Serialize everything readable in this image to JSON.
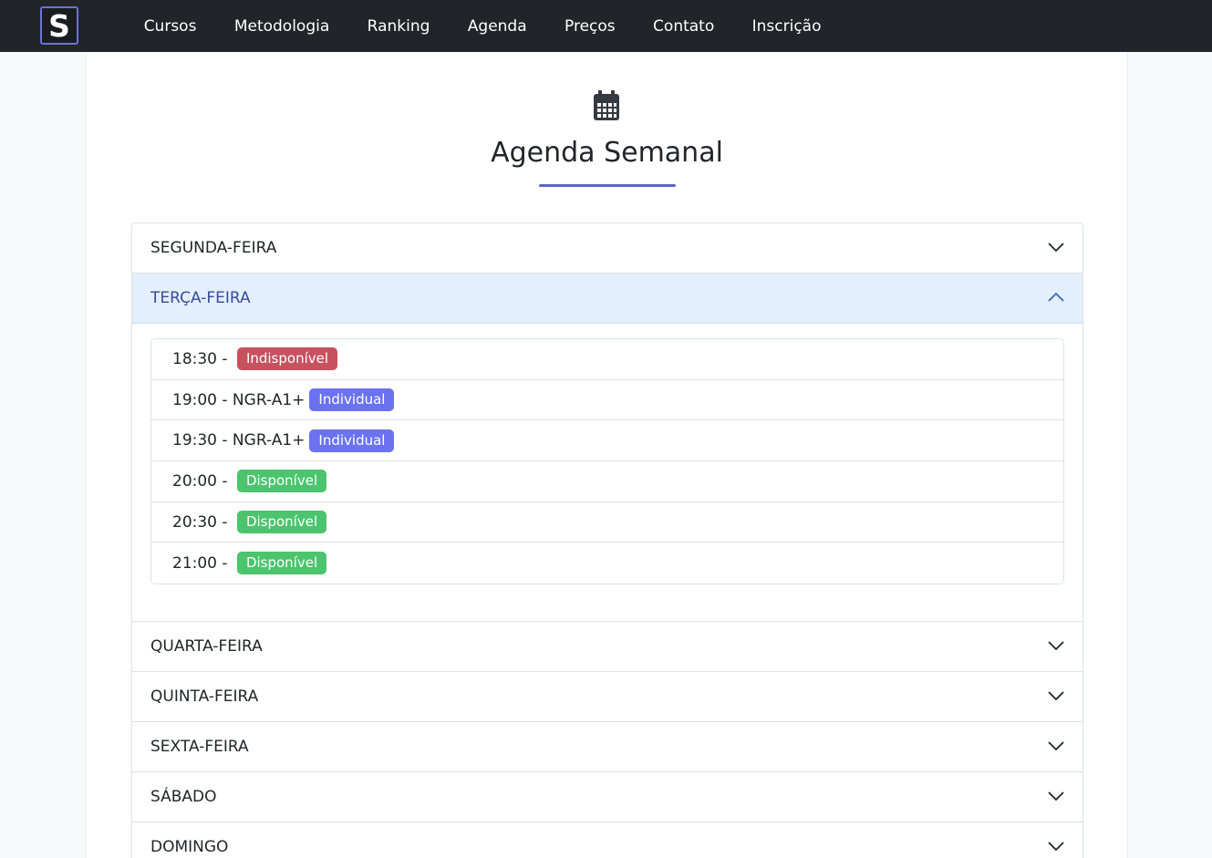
{
  "logo": {
    "letter": "S"
  },
  "nav": [
    {
      "label": "Cursos"
    },
    {
      "label": "Metodologia"
    },
    {
      "label": "Ranking"
    },
    {
      "label": "Agenda"
    },
    {
      "label": "Preços"
    },
    {
      "label": "Contato"
    },
    {
      "label": "Inscrição"
    }
  ],
  "page": {
    "icon": "calendar-icon",
    "title": "Agenda Semanal"
  },
  "days": [
    {
      "label": "SEGUNDA-FEIRA"
    },
    {
      "label": "TERÇA-FEIRA"
    },
    {
      "label": "QUARTA-FEIRA"
    },
    {
      "label": "QUINTA-FEIRA"
    },
    {
      "label": "SEXTA-FEIRA"
    },
    {
      "label": "SÁBADO"
    },
    {
      "label": "DOMINGO"
    }
  ],
  "tuesday_slots": [
    {
      "text": "18:30 - ",
      "badge": "Indisponível",
      "status": "unavailable",
      "color": "#c7515f"
    },
    {
      "text": "19:00 - NGR-A1+",
      "badge": "Individual",
      "status": "individual",
      "color": "#6b72f0"
    },
    {
      "text": "19:30 - NGR-A1+",
      "badge": "Individual",
      "status": "individual",
      "color": "#6b72f0"
    },
    {
      "text": "20:00 - ",
      "badge": "Disponível",
      "status": "available",
      "color": "#4cc46e"
    },
    {
      "text": "20:30 - ",
      "badge": "Disponível",
      "status": "available",
      "color": "#4cc46e"
    },
    {
      "text": "21:00 - ",
      "badge": "Disponível",
      "status": "available",
      "color": "#4cc46e"
    }
  ],
  "colors": {
    "navbar": "#212529",
    "accent": "#5a63c7",
    "open_header_bg": "#e3effc"
  }
}
